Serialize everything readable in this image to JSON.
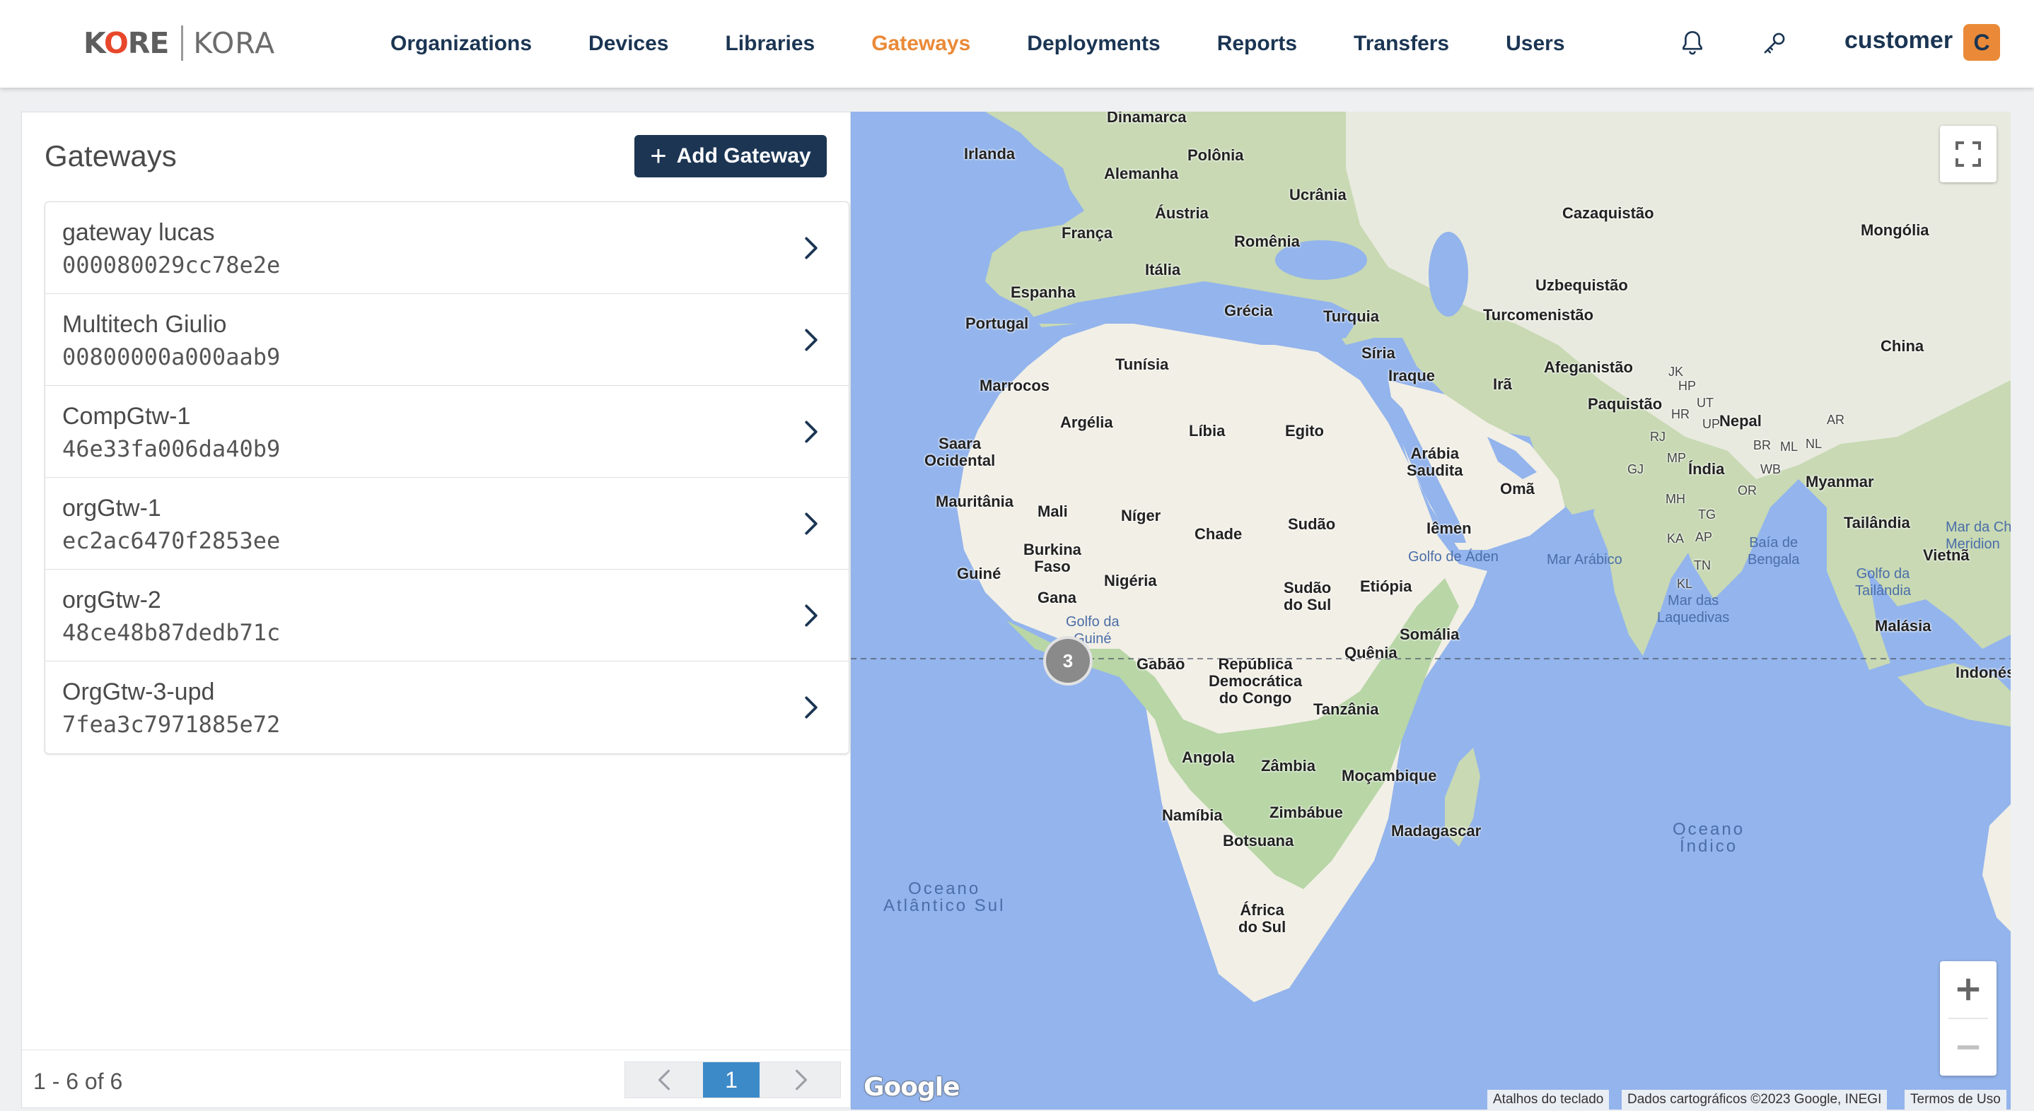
{
  "header": {
    "logo_brand": "KORE",
    "logo_product": "KORA",
    "nav": [
      {
        "label": "Organizations",
        "active": false
      },
      {
        "label": "Devices",
        "active": false
      },
      {
        "label": "Libraries",
        "active": false
      },
      {
        "label": "Gateways",
        "active": true
      },
      {
        "label": "Deployments",
        "active": false
      },
      {
        "label": "Reports",
        "active": false
      },
      {
        "label": "Transfers",
        "active": false
      },
      {
        "label": "Users",
        "active": false
      }
    ],
    "icons": [
      "bell-icon",
      "key-icon"
    ],
    "user_name": "customer",
    "user_initial": "C",
    "accent_color": "#ea8a38",
    "brand_color": "#1b3553"
  },
  "gateways_panel": {
    "title": "Gateways",
    "add_button_label": "Add Gateway",
    "items": [
      {
        "name": "gateway lucas",
        "eui": "000080029cc78e2e"
      },
      {
        "name": "Multitech Giulio",
        "eui": "00800000a000aab9"
      },
      {
        "name": "CompGtw-1",
        "eui": "46e33fa006da40b9"
      },
      {
        "name": "orgGtw-1",
        "eui": "ec2ac6470f2853ee"
      },
      {
        "name": "orgGtw-2",
        "eui": "48ce48b87dedb71c"
      },
      {
        "name": "OrgGtw-3-upd",
        "eui": "7fea3c7971885e72"
      }
    ],
    "pagination": {
      "range": "1 - 6 of 6",
      "current_page": "1"
    }
  },
  "map": {
    "cluster_count": "3",
    "provider": "Google",
    "attribution": {
      "shortcuts": "Atalhos do teclado",
      "data": "Dados cartográficos ©2023 Google, INEGI",
      "terms": "Termos de Uso"
    },
    "labels": {
      "dinamarca": "Dinamarca",
      "irlanda": "Irlanda",
      "alemanha": "Alemanha",
      "polonia": "Polônia",
      "ucrania": "Ucrânia",
      "cazaquistao": "Cazaquistão",
      "mongolia": "Mongólia",
      "austria": "Áustria",
      "franca": "França",
      "romenia": "Romênia",
      "italia": "Itália",
      "uzbequistao": "Uzbequistão",
      "espanha": "Espanha",
      "grecia": "Grécia",
      "turquia": "Turquia",
      "turcomenistao": "Turcomenistão",
      "portugal": "Portugal",
      "china": "China",
      "siria": "Síria",
      "tunisia": "Tunísia",
      "iraque": "Iraque",
      "afeganistao": "Afeganistão",
      "ira": "Irã",
      "marrocos": "Marrocos",
      "paquistao": "Paquistão",
      "nepal": "Nepal",
      "argelia": "Argélia",
      "libia": "Líbia",
      "egito": "Egito",
      "saara": "Saara\nOcidental",
      "arabia": "Arábia\nSaudita",
      "india": "Índia",
      "oma": "Omã",
      "myanmar": "Myanmar",
      "mauritania": "Mauritânia",
      "mali": "Mali",
      "niger": "Níger",
      "sudao": "Sudão",
      "chade": "Chade",
      "iemen": "Iêmen",
      "tailandia": "Tailândia",
      "burkina": "Burkina\nFaso",
      "guine": "Guiné",
      "nigeria": "Nigéria",
      "gana": "Gana",
      "sudao_sul": "Sudão\ndo Sul",
      "etiopia": "Etiópia",
      "vietna": "Vietnã",
      "somalia": "Somália",
      "malasia": "Malásia",
      "gabao": "Gabão",
      "rdc": "República\nDemocrática\ndo Congo",
      "quenia": "Quênia",
      "indone": "Indonés",
      "tanzania": "Tanzânia",
      "angola": "Angola",
      "zambia": "Zâmbia",
      "mocambique": "Moçambique",
      "namibia": "Namíbia",
      "zimbabue": "Zimbábue",
      "madagascar": "Madagascar",
      "botsuana": "Botsuana",
      "africa_sul": "África\ndo Sul",
      "golfo_aden": "Golfo de Áden",
      "mar_arabico": "Mar Arábico",
      "baia_bengala": "Baía de\nBengala",
      "golfo_guine": "Golfo da\nGuiné",
      "mar_laquedivas": "Mar das\nLaquedivas",
      "golfo_tailandia": "Golfo da\nTailândia",
      "mar_china": "Mar da Ch\nMeridion",
      "oceano_atlantico": "Oceano\nAtlântico Sul",
      "oceano_indico": "Oceano\nÍndico",
      "jk": "JK",
      "hp": "HP",
      "ut": "UT",
      "hr": "HR",
      "up": "UP",
      "rj": "RJ",
      "gj": "GJ",
      "mp": "MP",
      "br": "BR",
      "ml": "ML",
      "nl": "NL",
      "ar": "AR",
      "wb": "WB",
      "or": "OR",
      "mh": "MH",
      "tg": "TG",
      "ka": "KA",
      "ap": "AP",
      "tn": "TN",
      "kl": "KL"
    }
  }
}
